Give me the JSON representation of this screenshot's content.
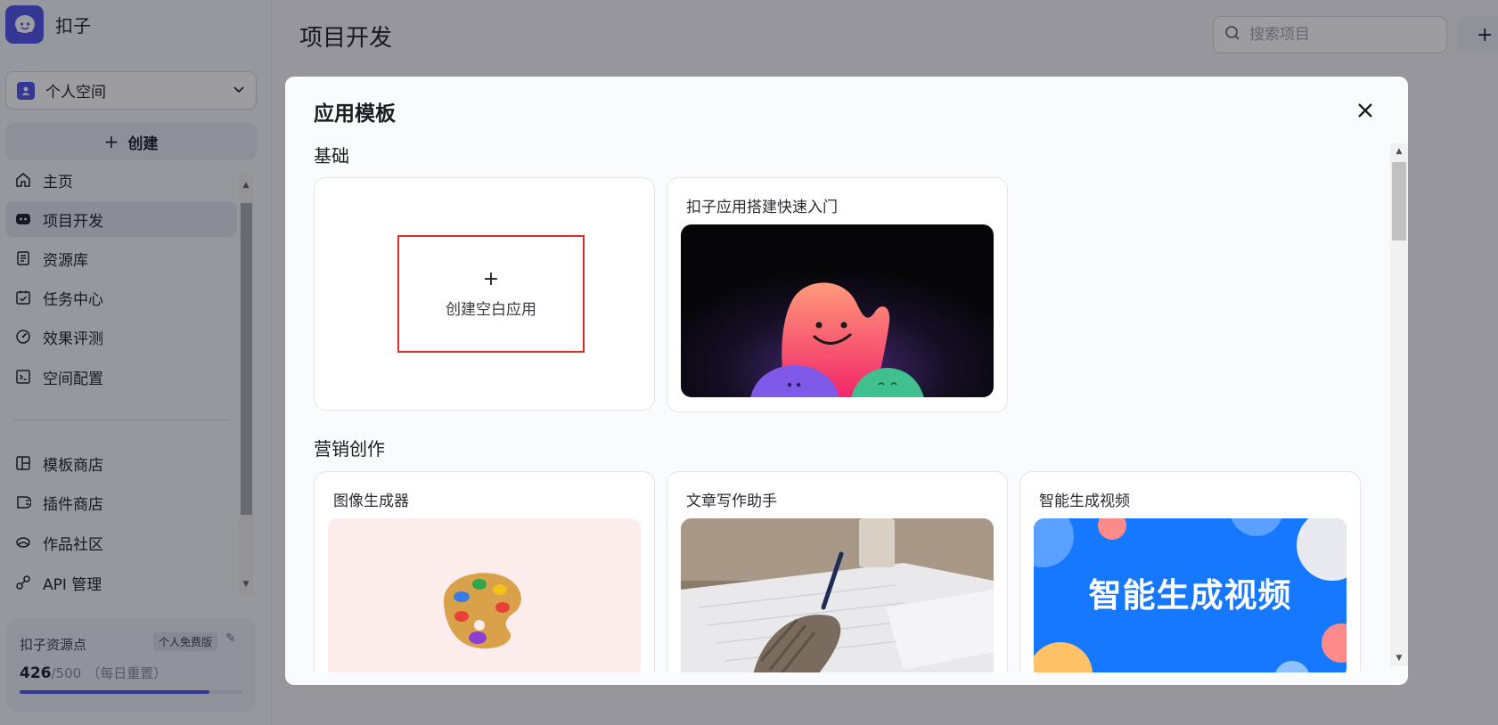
{
  "app": {
    "name": "扣子"
  },
  "sidebar": {
    "space": "个人空间",
    "create_label": "创建",
    "nav": [
      {
        "label": "主页",
        "icon": "home-icon"
      },
      {
        "label": "项目开发",
        "icon": "project-icon"
      },
      {
        "label": "资源库",
        "icon": "library-icon"
      },
      {
        "label": "任务中心",
        "icon": "task-icon"
      },
      {
        "label": "效果评测",
        "icon": "evaluation-icon"
      },
      {
        "label": "空间配置",
        "icon": "settings-icon"
      },
      {
        "label": "模板商店",
        "icon": "template-icon"
      },
      {
        "label": "插件商店",
        "icon": "plugin-icon"
      },
      {
        "label": "作品社区",
        "icon": "community-icon"
      },
      {
        "label": "API 管理",
        "icon": "api-icon"
      }
    ],
    "quota": {
      "title": "扣子资源点",
      "badge": "个人免费版",
      "used": "426",
      "max": "/500",
      "reset": "（每日重置）",
      "fraction": 0.852
    }
  },
  "header": {
    "title": "项目开发",
    "search_placeholder": "搜索项目",
    "add_label": "+"
  },
  "modal": {
    "title": "应用模板",
    "sections": [
      {
        "title": "基础",
        "cards": [
          {
            "blank_plus": "+",
            "blank_label": "创建空白应用"
          },
          {
            "title": "扣子应用搭建快速入门"
          }
        ]
      },
      {
        "title": "营销创作",
        "cards": [
          {
            "title": "图像生成器"
          },
          {
            "title": "文章写作助手"
          },
          {
            "title": "智能生成视频",
            "image_text": "智能生成视频"
          }
        ]
      }
    ]
  },
  "colors": {
    "accent": "#4d53e8",
    "highlight_border": "#e12b2b",
    "video_bg": "#1677ff",
    "image_bg": "#fdecec"
  }
}
